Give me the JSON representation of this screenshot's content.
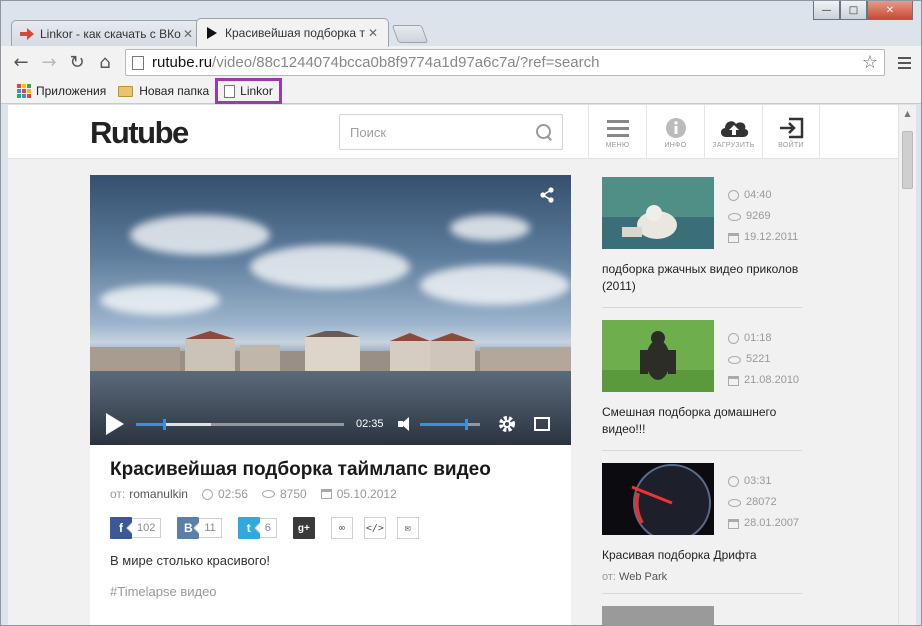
{
  "browser": {
    "tabs": [
      {
        "title": "Linkor - как скачать с ВКо",
        "active": false,
        "icon": "arrow-icon"
      },
      {
        "title": "Красивейшая подборка т",
        "active": true,
        "icon": "play-favicon"
      }
    ],
    "url_host": "rutube.ru",
    "url_path": "/video/88c1244074bcca0b8f9774a1d97a6c7a/?ref=search",
    "bookmarks": [
      {
        "label": "Приложения",
        "icon": "apps-icon"
      },
      {
        "label": "Новая папка",
        "icon": "folder-icon"
      },
      {
        "label": "Linkor",
        "icon": "page-icon",
        "highlighted": true
      }
    ],
    "highlight_color": "#9b3aa8"
  },
  "site": {
    "logo": "Rutube",
    "search_placeholder": "Поиск",
    "nav": [
      {
        "label": "МЕНЮ",
        "icon": "menu-icon"
      },
      {
        "label": "ИНФО",
        "icon": "info-icon"
      },
      {
        "label": "ЗАГРУЗИТЬ",
        "icon": "upload-icon"
      },
      {
        "label": "ВОЙТИ",
        "icon": "login-icon"
      }
    ]
  },
  "player": {
    "current_time": "02:35",
    "progress_fraction": 0.13,
    "buffered_fraction": 0.36,
    "volume_fraction": 0.75,
    "accent_color": "#3b8fe0"
  },
  "video": {
    "title": "Красивейшая подборка таймлапс видео",
    "author_prefix": "от:",
    "author": "romanulkin",
    "duration": "02:56",
    "views": "8750",
    "date": "05.10.2012",
    "description": "В мире столько красивого!",
    "tag": "#Timelapse видео"
  },
  "share": [
    {
      "network": "facebook",
      "label": "f",
      "count": "102",
      "color": "#3b5998"
    },
    {
      "network": "vkontakte",
      "label": "B",
      "count": "11",
      "color": "#5b7fa6"
    },
    {
      "network": "twitter",
      "label": "t",
      "count": "6",
      "color": "#2fa9e0"
    },
    {
      "network": "google-plus",
      "label": "g+",
      "count": "",
      "color": "#3a3a3a"
    }
  ],
  "tools": [
    {
      "name": "link",
      "glyph": "∞"
    },
    {
      "name": "embed",
      "glyph": "</>"
    },
    {
      "name": "email",
      "glyph": "✉"
    }
  ],
  "related": [
    {
      "title": "подборка ржачных видео приколов (2011)",
      "duration": "04:40",
      "views": "9269",
      "date": "19.12.2011",
      "author": ""
    },
    {
      "title": "Смешная подборка домашнего видео!!!",
      "duration": "01:18",
      "views": "5221",
      "date": "21.08.2010",
      "author": ""
    },
    {
      "title": "Красивая подборка Дрифта",
      "duration": "03:31",
      "views": "28072",
      "date": "28.01.2007",
      "author_prefix": "от:",
      "author": "Web Park"
    }
  ]
}
